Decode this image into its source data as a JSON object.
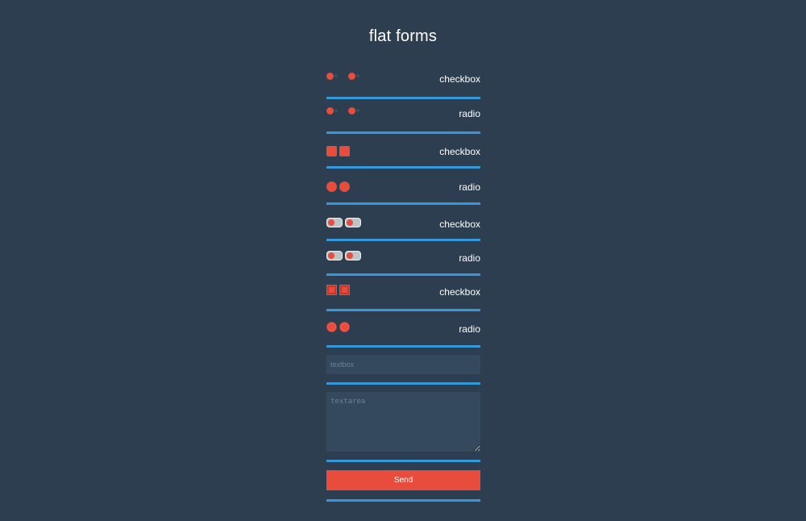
{
  "page": {
    "title": "flat forms"
  },
  "rows": [
    {
      "label": "checkbox",
      "style": "dot"
    },
    {
      "label": "radio",
      "style": "dot"
    },
    {
      "label": "checkbox",
      "style": "square"
    },
    {
      "label": "radio",
      "style": "circle"
    },
    {
      "label": "checkbox",
      "style": "toggle"
    },
    {
      "label": "radio",
      "style": "toggle"
    },
    {
      "label": "checkbox",
      "style": "square-bordered"
    },
    {
      "label": "radio",
      "style": "circle-bordered"
    }
  ],
  "textbox": {
    "placeholder": "textbox",
    "value": ""
  },
  "textarea": {
    "placeholder": "textarea",
    "value": ""
  },
  "send_button": {
    "label": "Send"
  },
  "colors": {
    "background": "#2c3e50",
    "accent_line": "#3498db",
    "control": "#e74c3c",
    "field_bg": "#34495e"
  }
}
